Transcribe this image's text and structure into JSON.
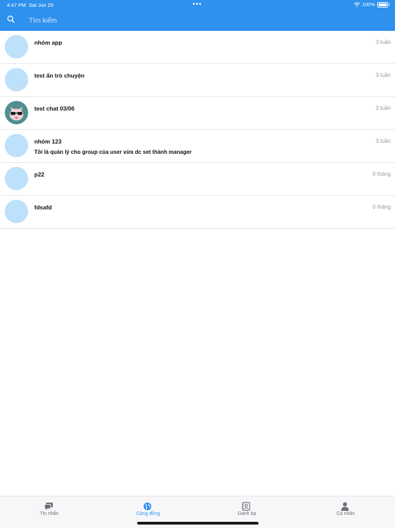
{
  "status": {
    "time": "4:47 PM",
    "date": "Sat Jun 25",
    "dots": "•••",
    "battery": "100%"
  },
  "search": {
    "placeholder": "Tìm kiếm",
    "icon": "search-icon"
  },
  "conversations": [
    {
      "title": "nhóm app",
      "message": "",
      "time": "3 tuần",
      "avatar": "placeholder"
    },
    {
      "title": "test ẩn trò chuyện",
      "message": "",
      "time": "3 tuần",
      "avatar": "placeholder"
    },
    {
      "title": "test chat 03/06",
      "message": "",
      "time": "3 tuần",
      "avatar": "raccoon-sunglasses"
    },
    {
      "title": "nhóm 123",
      "message": "Tôi là quản lý cho group của user vừa dc set thành manager",
      "time": "3 tuần",
      "avatar": "placeholder"
    },
    {
      "title": "p22",
      "message": "",
      "time": "0 tháng",
      "avatar": "placeholder"
    },
    {
      "title": "fdsafd",
      "message": "",
      "time": "0 tháng",
      "avatar": "placeholder"
    }
  ],
  "tabs": [
    {
      "label": "Tin nhắn",
      "icon": "chat-bubbles-icon",
      "active": false
    },
    {
      "label": "Cộng đồng",
      "icon": "globe-icon",
      "active": true
    },
    {
      "label": "Danh bạ",
      "icon": "contacts-book-icon",
      "active": false
    },
    {
      "label": "Cá nhân",
      "icon": "person-icon",
      "active": false
    }
  ],
  "colors": {
    "accent": "#2e91ee",
    "avatar_placeholder": "#bde0fb",
    "time_text": "#9a9a9a",
    "tab_inactive": "#6d6d72"
  }
}
